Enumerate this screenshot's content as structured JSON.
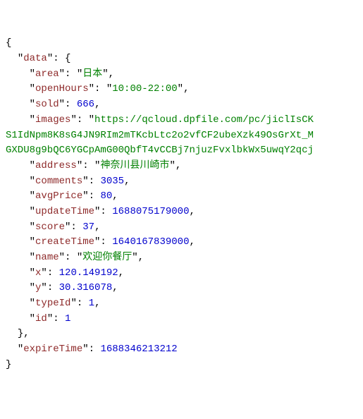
{
  "json": {
    "data": {
      "area": "日本",
      "openHours": "10:00-22:00",
      "sold": 666,
      "images": "https://qcloud.dpfile.com/pc/jiclIsCKmOI2arxKN9PtaGBuJur56CcS1IdNpm8K8sG4JN9RIm2mTKcbLtc2o2vfCF2ubeXzk49OsGrXt_MQoVqtwByPVrY6V2qz4Ep8pAzwTtzsmrxlRLsuBrmGXDU8g9bQC6YGCpAmG00QbfT4vCCBj7njuzFvxlbkWx5uwqY2qcjixplkU0Yk0MsVrQvaLsw0zHDMBL",
      "address": "神奈川县川崎市",
      "comments": 3035,
      "avgPrice": 80,
      "updateTime": 1688075179000,
      "score": 37,
      "createTime": 1640167839000,
      "name": "欢迎你餐厅",
      "x": 120.149192,
      "y": 30.316078,
      "typeId": 1,
      "id": 1
    },
    "expireTime": 1688346213212
  },
  "keys": {
    "data": "data",
    "area": "area",
    "openHours": "openHours",
    "sold": "sold",
    "images": "images",
    "address": "address",
    "comments": "comments",
    "avgPrice": "avgPrice",
    "updateTime": "updateTime",
    "score": "score",
    "createTime": "createTime",
    "name": "name",
    "x": "x",
    "y": "y",
    "typeId": "typeId",
    "id": "id",
    "expireTime": "expireTime"
  },
  "images_line1": "https://qcloud.dpfile.com/pc/jiclIsCK",
  "images_line2": "S1IdNpm8K8sG4JN9RIm2mTKcbLtc2o2vfCF2ubeXzk49OsGrXt_M",
  "images_line3": "GXDU8g9bQC6YGCpAmG00QbfT4vCCBj7njuzFvxlbkWx5uwqY2qcj"
}
